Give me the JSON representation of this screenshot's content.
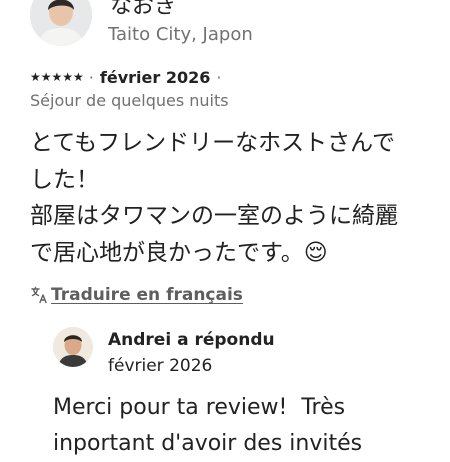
{
  "review": {
    "reviewer_name": "なおき",
    "reviewer_location": "Taito City, Japon",
    "rating": 5,
    "stars": "★★★★★",
    "separator": "·",
    "date": "février 2026",
    "date_trail": "·",
    "stay_type": "Séjour de quelques nuits",
    "text": "とてもフレンドリーなホストさんで\nした！\n部屋はタワマンの一室のように綺麗\nで居心地が良かったです。😌"
  },
  "translate": {
    "icon": "translate-icon",
    "label": "Traduire en français"
  },
  "host_response": {
    "header": "Andrei a répondu",
    "date": "février 2026",
    "text": "Merci pour ta review!  Très\ninportant d'avoir des invités"
  }
}
